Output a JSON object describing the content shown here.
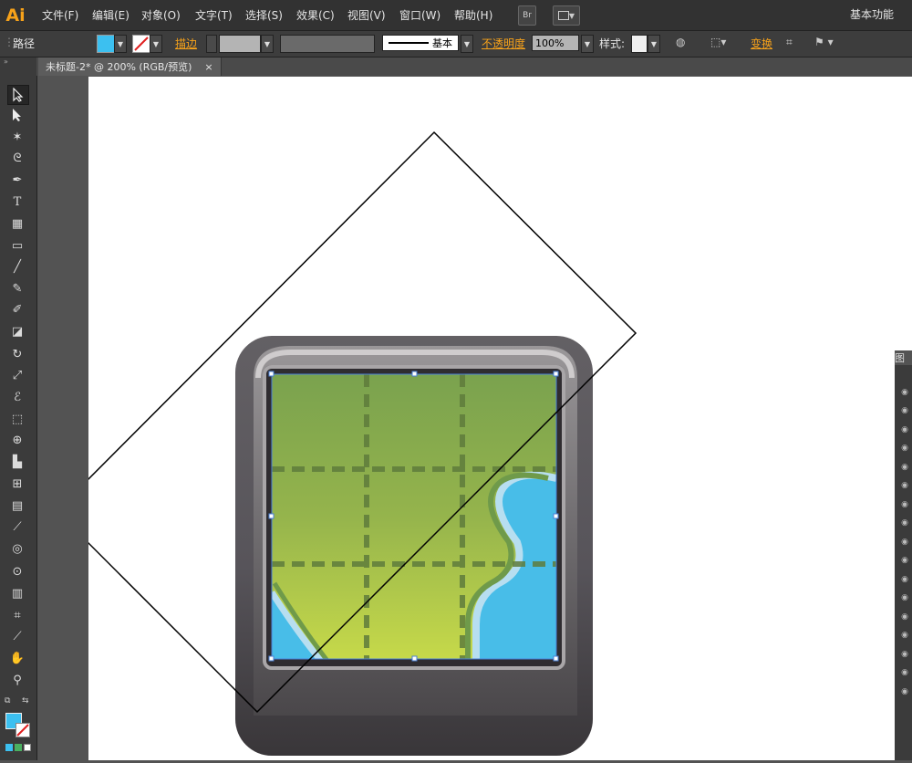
{
  "app": {
    "logo": "Ai"
  },
  "menu": {
    "items": [
      "文件(F)",
      "编辑(E)",
      "对象(O)",
      "文字(T)",
      "选择(S)",
      "效果(C)",
      "视图(V)",
      "窗口(W)",
      "帮助(H)"
    ],
    "bridge": "Br",
    "workspace": "基本功能"
  },
  "control": {
    "selection_type": "路径",
    "stroke_label": "描边",
    "stroke_style": "基本",
    "opacity_label": "不透明度",
    "opacity_value": "100%",
    "style_label": "样式:",
    "transform_label": "变换",
    "fill_color": "#3cc0f0",
    "accent": "#f7a21a"
  },
  "document": {
    "tab_title": "未标题-2* @ 200% (RGB/预览)",
    "close_glyph": "×"
  },
  "panel": {
    "title": "图"
  },
  "tools": [
    "selection-tool",
    "direct-selection-tool",
    "magic-wand-tool",
    "lasso-tool",
    "pen-tool",
    "type-tool",
    "line-tool",
    "rectangle-tool",
    "paintbrush-tool",
    "pencil-tool",
    "blob-brush-tool",
    "eraser-tool",
    "rotate-tool",
    "scale-tool",
    "warp-tool",
    "free-transform-tool",
    "shape-builder-tool",
    "perspective-grid-tool",
    "mesh-tool",
    "gradient-tool",
    "eyedropper-tool",
    "blend-tool",
    "symbol-sprayer-tool",
    "column-graph-tool",
    "artboard-tool",
    "slice-tool",
    "hand-tool",
    "zoom-tool"
  ],
  "colors": {
    "fill": "#3cc0f0",
    "stroke": "none"
  }
}
